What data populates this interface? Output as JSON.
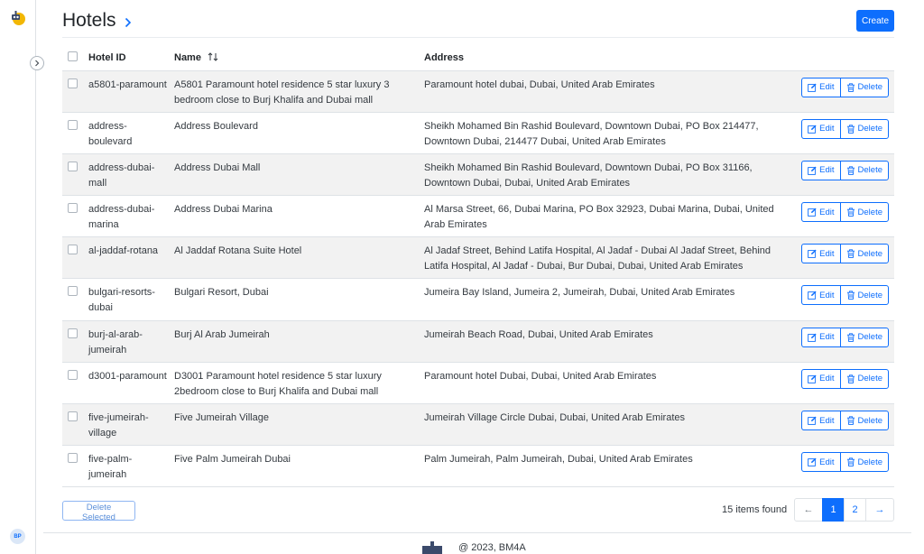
{
  "sidebar": {
    "avatar_initials": "BP",
    "logo_icon": "bot-logo-icon",
    "collapse_icon": "chevron-right-icon"
  },
  "header": {
    "title": "Hotels",
    "title_icon": "chevron-right-icon",
    "create_label": "Create"
  },
  "table": {
    "columns": {
      "id": "Hotel ID",
      "name": "Name",
      "address": "Address",
      "sort_icon": "sort-icon"
    },
    "edit_label": "Edit",
    "delete_label": "Delete",
    "rows": [
      {
        "id": "a5801-paramount",
        "name": "A5801 Paramount hotel residence 5 star luxury 3 bedroom close to Burj Khalifa and Dubai mall",
        "address": "Paramount hotel dubai, Dubai, United Arab Emirates"
      },
      {
        "id": "address-boulevard",
        "name": "Address Boulevard",
        "address": "Sheikh Mohamed Bin Rashid Boulevard, Downtown Dubai, PO Box 214477, Downtown Dubai, 214477 Dubai, United Arab Emirates"
      },
      {
        "id": "address-dubai-mall",
        "name": "Address Dubai Mall",
        "address": "Sheikh Mohamed Bin Rashid Boulevard, Downtown Dubai, PO Box 31166, Downtown Dubai, Dubai, United Arab Emirates"
      },
      {
        "id": "address-dubai-marina",
        "name": "Address Dubai Marina",
        "address": "Al Marsa Street, 66, Dubai Marina, PO Box 32923, Dubai Marina, Dubai, United Arab Emirates"
      },
      {
        "id": "al-jaddaf-rotana",
        "name": "Al Jaddaf Rotana Suite Hotel",
        "address": "Al Jadaf Street, Behind Latifa Hospital, Al Jadaf - Dubai Al Jadaf Street, Behind Latifa Hospital, Al Jadaf - Dubai, Bur Dubai, Dubai, United Arab Emirates"
      },
      {
        "id": "bulgari-resorts-dubai",
        "name": "Bulgari Resort, Dubai",
        "address": "Jumeira Bay Island, Jumeira 2, Jumeirah, Dubai, United Arab Emirates"
      },
      {
        "id": "burj-al-arab-jumeirah",
        "name": "Burj Al Arab Jumeirah",
        "address": "Jumeirah Beach Road, Dubai, United Arab Emirates"
      },
      {
        "id": "d3001-paramount",
        "name": "D3001 Paramount hotel residence 5 star luxury 2bedroom close to Burj Khalifa and Dubai mall",
        "address": "Paramount hotel Dubai, Dubai, United Arab Emirates"
      },
      {
        "id": "five-jumeirah-village",
        "name": "Five Jumeirah Village",
        "address": "Jumeirah Village Circle Dubai, Dubai, United Arab Emirates"
      },
      {
        "id": "five-palm-jumeirah",
        "name": "Five Palm Jumeirah Dubai",
        "address": "Palm Jumeirah, Palm Jumeirah, Dubai, United Arab Emirates"
      }
    ]
  },
  "bottom": {
    "delete_selected_label": "Delete Selected",
    "items_found": "15 items found",
    "pagination": {
      "prev": "←",
      "pages": [
        "1",
        "2"
      ],
      "next": "→",
      "current": "1"
    }
  },
  "footer": {
    "text": "@ 2023, BM4A",
    "logo_icon": "bm4a-logo-icon"
  },
  "colors": {
    "accent": "#0d6efd",
    "stripe": "#f2f2f2",
    "border": "#dee2e6"
  }
}
